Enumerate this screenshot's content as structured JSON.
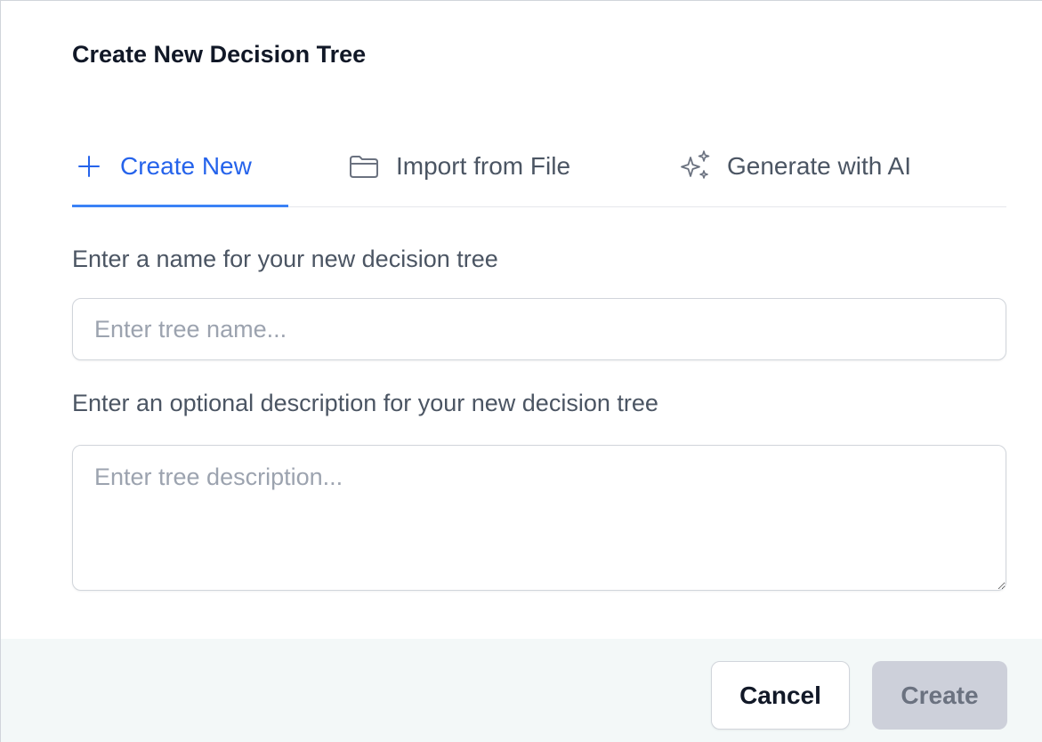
{
  "dialog": {
    "title": "Create New Decision Tree"
  },
  "tabs": [
    {
      "label": "Create New",
      "icon": "plus-icon",
      "active": true
    },
    {
      "label": "Import from File",
      "icon": "folder-icon",
      "active": false
    },
    {
      "label": "Generate with AI",
      "icon": "sparkles-icon",
      "active": false
    }
  ],
  "form": {
    "name_label": "Enter a name for your new decision tree",
    "name_placeholder": "Enter tree name...",
    "name_value": "",
    "description_label": "Enter an optional description for your new decision tree",
    "description_placeholder": "Enter tree description...",
    "description_value": ""
  },
  "footer": {
    "cancel_label": "Cancel",
    "create_label": "Create",
    "create_disabled": true
  },
  "colors": {
    "accent": "#2563eb",
    "tab_underline": "#3b82f6",
    "footer_bg": "#f3f8f8",
    "disabled_button_bg": "#cdd0da"
  }
}
